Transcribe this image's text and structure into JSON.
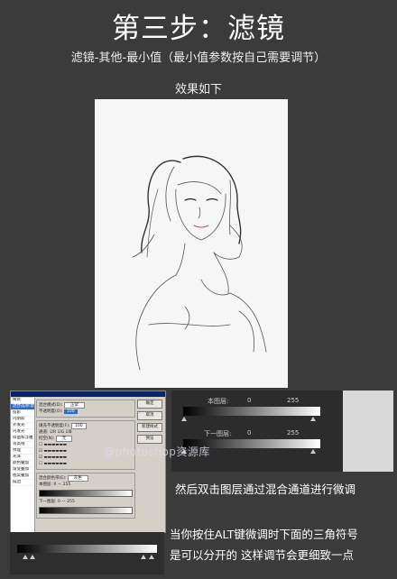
{
  "title": "第三步：滤镜",
  "subtitle": "滤镜-其他-最小值（最小值参数按自己需要调节）",
  "effect_caption": "效果如下",
  "watermark": "@photoshop资源库",
  "notes": {
    "line1": "然后双击图层通过混合通道进行微调",
    "line2": "当你按住ALT键微调时下面的三角符号",
    "line3": "是可以分开的 这样调节会更细致一点"
  },
  "blend_panel": {
    "this_layer_label": "本图层:",
    "this_layer_min": "0",
    "this_layer_max": "255",
    "below_layer_label": "下一图层:",
    "below_layer_min": "0",
    "below_layer_max": "255"
  },
  "dialog": {
    "side_items": [
      "样式",
      "混合选项:默认",
      "投影",
      "内阴影",
      "外发光",
      "内发光",
      "斜面和浮雕",
      "等高线",
      "纹理",
      "光泽",
      "颜色叠加",
      "渐变叠加",
      "图案叠加",
      "描边"
    ],
    "blend_mode_label": "混合模式(D):",
    "blend_mode_value": "正常",
    "opacity_label": "不透明度(O):",
    "opacity_value": "100",
    "fill_label": "填充不透明度(F):",
    "fill_value": "100",
    "channel_label": "通道:",
    "knockout_label": "挖空(N):",
    "knockout_value": "无",
    "blend_if_label": "混合颜色带(E):",
    "blend_if_value": "灰色",
    "this_layer_label": "本图层:",
    "this_layer_min": "0",
    "this_layer_max": "255",
    "below_layer_label": "下一图层:",
    "below_layer_min": "0",
    "below_layer_max": "255",
    "ok": "确定",
    "cancel": "取消",
    "new_style": "新建样式",
    "preview": "预览"
  }
}
